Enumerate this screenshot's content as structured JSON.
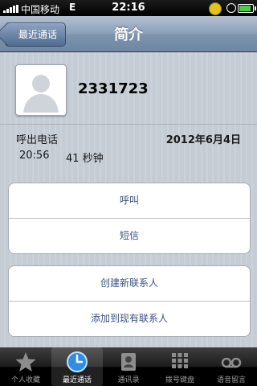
{
  "status_bar": {
    "carrier": "中国移动",
    "network": "E",
    "time": "22:16",
    "battery_level": 0.85,
    "icons": [
      "signal-icon",
      "status-circle-icon",
      "rotation-lock-icon",
      "battery-icon"
    ]
  },
  "nav": {
    "back_label": "最近通话",
    "title": "简介"
  },
  "contact": {
    "name": "2331723"
  },
  "call": {
    "type": "呼出电话",
    "date": "2012年6月4日",
    "time": "20:56",
    "duration": "41 秒钟"
  },
  "actions": {
    "call": "呼叫",
    "message": "短信",
    "create_contact": "创建新联系人",
    "add_to_existing": "添加到现有联系人"
  },
  "tabs": [
    {
      "label": "个人收藏",
      "icon": "star-icon",
      "active": false
    },
    {
      "label": "最近通话",
      "icon": "clock-icon",
      "active": true
    },
    {
      "label": "通讯录",
      "icon": "contacts-icon",
      "active": false
    },
    {
      "label": "拨号键盘",
      "icon": "keypad-icon",
      "active": false
    },
    {
      "label": "语音留言",
      "icon": "voicemail-icon",
      "active": false
    }
  ],
  "colors": {
    "nav_bar": "#7e94af",
    "action_text": "#3a5282",
    "background": "#c5ccd4"
  }
}
